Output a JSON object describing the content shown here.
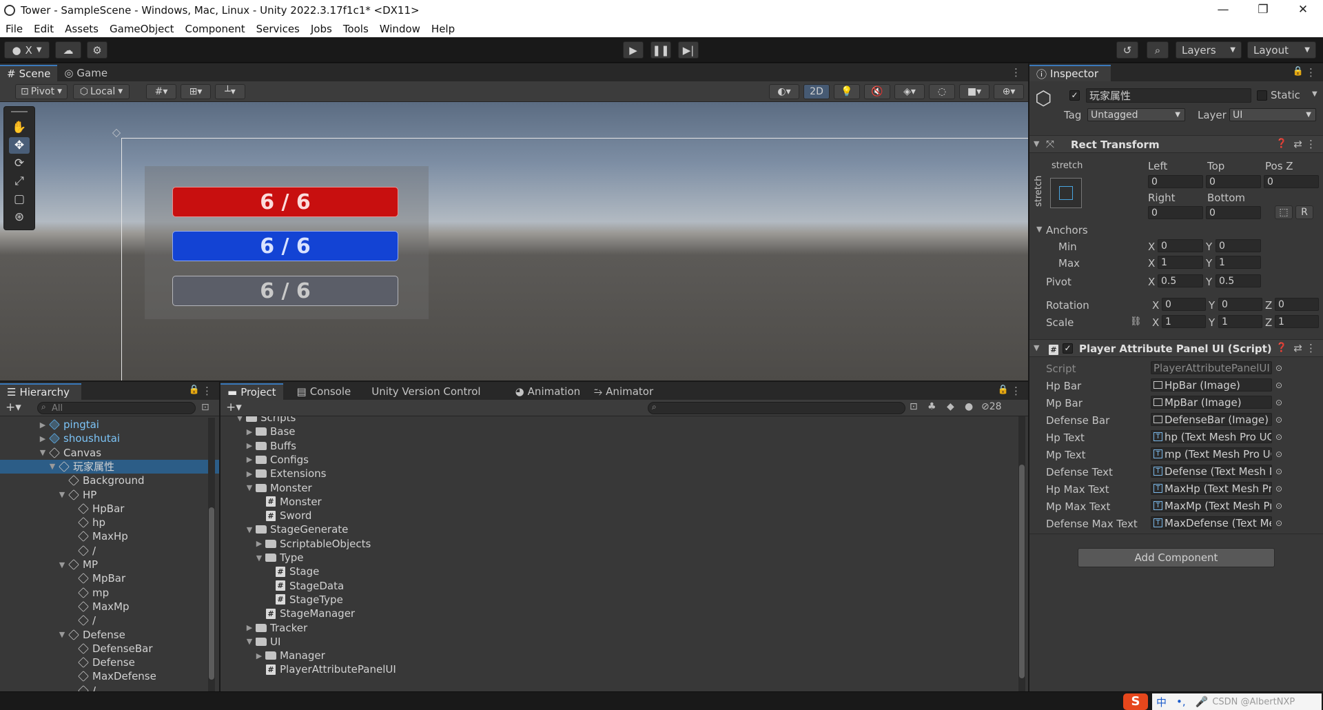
{
  "window": {
    "title": "Tower - SampleScene - Windows, Mac, Linux - Unity 2022.3.17f1c1* <DX11>"
  },
  "menu": [
    "File",
    "Edit",
    "Assets",
    "GameObject",
    "Component",
    "Services",
    "Jobs",
    "Tools",
    "Window",
    "Help"
  ],
  "toolbar": {
    "account_label": "X",
    "layers_label": "Layers",
    "layout_label": "Layout"
  },
  "scene": {
    "tabs": [
      "Scene",
      "Game"
    ],
    "pivot_label": "Pivot",
    "local_label": "Local",
    "mode_2d": "2D",
    "bars": [
      {
        "text": "6 / 6",
        "color": "#c80f0f"
      },
      {
        "text": "6 / 6",
        "color": "#1343d4"
      },
      {
        "text": "6 / 6",
        "color": "#5b5e68"
      }
    ]
  },
  "hierarchy": {
    "title": "Hierarchy",
    "search_placeholder": "All",
    "items": [
      {
        "label": "pingtai",
        "depth": 2,
        "arrow": "▶",
        "icon": "prefab"
      },
      {
        "label": "shoushutai",
        "depth": 2,
        "arrow": "▶",
        "icon": "prefab"
      },
      {
        "label": "Canvas",
        "depth": 2,
        "arrow": "▼",
        "icon": "cube"
      },
      {
        "label": "玩家属性",
        "depth": 3,
        "arrow": "▼",
        "icon": "cube",
        "selected": true
      },
      {
        "label": "Background",
        "depth": 4,
        "arrow": "",
        "icon": "cube"
      },
      {
        "label": "HP",
        "depth": 4,
        "arrow": "▼",
        "icon": "cube"
      },
      {
        "label": "HpBar",
        "depth": 5,
        "arrow": "",
        "icon": "cube"
      },
      {
        "label": "hp",
        "depth": 5,
        "arrow": "",
        "icon": "cube"
      },
      {
        "label": "MaxHp",
        "depth": 5,
        "arrow": "",
        "icon": "cube"
      },
      {
        "label": "/",
        "depth": 5,
        "arrow": "",
        "icon": "cube"
      },
      {
        "label": "MP",
        "depth": 4,
        "arrow": "▼",
        "icon": "cube"
      },
      {
        "label": "MpBar",
        "depth": 5,
        "arrow": "",
        "icon": "cube"
      },
      {
        "label": "mp",
        "depth": 5,
        "arrow": "",
        "icon": "cube"
      },
      {
        "label": "MaxMp",
        "depth": 5,
        "arrow": "",
        "icon": "cube"
      },
      {
        "label": "/",
        "depth": 5,
        "arrow": "",
        "icon": "cube"
      },
      {
        "label": "Defense",
        "depth": 4,
        "arrow": "▼",
        "icon": "cube"
      },
      {
        "label": "DefenseBar",
        "depth": 5,
        "arrow": "",
        "icon": "cube"
      },
      {
        "label": "Defense",
        "depth": 5,
        "arrow": "",
        "icon": "cube"
      },
      {
        "label": "MaxDefense",
        "depth": 5,
        "arrow": "",
        "icon": "cube"
      },
      {
        "label": "/",
        "depth": 5,
        "arrow": "",
        "icon": "cube"
      }
    ]
  },
  "project": {
    "tabs": [
      "Project",
      "Console",
      "Unity Version Control",
      "Animation",
      "Animator"
    ],
    "hidden_count": "28",
    "items": [
      {
        "label": "Scripts",
        "depth": 1,
        "arrow": "▼",
        "icon": "folder"
      },
      {
        "label": "Base",
        "depth": 2,
        "arrow": "▶",
        "icon": "folder"
      },
      {
        "label": "Buffs",
        "depth": 2,
        "arrow": "▶",
        "icon": "folder"
      },
      {
        "label": "Configs",
        "depth": 2,
        "arrow": "▶",
        "icon": "folder"
      },
      {
        "label": "Extensions",
        "depth": 2,
        "arrow": "▶",
        "icon": "folder"
      },
      {
        "label": "Monster",
        "depth": 2,
        "arrow": "▼",
        "icon": "folder"
      },
      {
        "label": "Monster",
        "depth": 3,
        "arrow": "",
        "icon": "script"
      },
      {
        "label": "Sword",
        "depth": 3,
        "arrow": "",
        "icon": "script"
      },
      {
        "label": "StageGenerate",
        "depth": 2,
        "arrow": "▼",
        "icon": "folder"
      },
      {
        "label": "ScriptableObjects",
        "depth": 3,
        "arrow": "▶",
        "icon": "folder"
      },
      {
        "label": "Type",
        "depth": 3,
        "arrow": "▼",
        "icon": "folder"
      },
      {
        "label": "Stage",
        "depth": 4,
        "arrow": "",
        "icon": "script"
      },
      {
        "label": "StageData",
        "depth": 4,
        "arrow": "",
        "icon": "script"
      },
      {
        "label": "StageType",
        "depth": 4,
        "arrow": "",
        "icon": "script"
      },
      {
        "label": "StageManager",
        "depth": 3,
        "arrow": "",
        "icon": "script"
      },
      {
        "label": "Tracker",
        "depth": 2,
        "arrow": "▶",
        "icon": "folder"
      },
      {
        "label": "UI",
        "depth": 2,
        "arrow": "▼",
        "icon": "folder"
      },
      {
        "label": "Manager",
        "depth": 3,
        "arrow": "▶",
        "icon": "folder"
      },
      {
        "label": "PlayerAttributePanelUI",
        "depth": 3,
        "arrow": "",
        "icon": "script"
      }
    ]
  },
  "inspector": {
    "title": "Inspector",
    "object_name": "玩家属性",
    "static_label": "Static",
    "tag_label": "Tag",
    "tag_value": "Untagged",
    "layer_label": "Layer",
    "layer_value": "UI",
    "rect": {
      "title": "Rect Transform",
      "stretch": "stretch",
      "left_label": "Left",
      "top_label": "Top",
      "posz_label": "Pos Z",
      "right_label": "Right",
      "bottom_label": "Bottom",
      "left": "0",
      "top": "0",
      "posz": "0",
      "right": "0",
      "bottom": "0",
      "r_btn": "R",
      "anchors_label": "Anchors",
      "min_label": "Min",
      "max_label": "Max",
      "pivot_label": "Pivot",
      "rotation_label": "Rotation",
      "scale_label": "Scale",
      "min_x": "0",
      "min_y": "0",
      "max_x": "1",
      "max_y": "1",
      "pivot_x": "0.5",
      "pivot_y": "0.5",
      "rot_x": "0",
      "rot_y": "0",
      "rot_z": "0",
      "scale_x": "1",
      "scale_y": "1",
      "scale_z": "1"
    },
    "script": {
      "title": "Player Attribute Panel UI (Script)",
      "fields": [
        {
          "label": "Script",
          "value": "PlayerAttributePanelUI",
          "kind": "script"
        },
        {
          "label": "Hp Bar",
          "value": "HpBar (Image)",
          "kind": "image"
        },
        {
          "label": "Mp Bar",
          "value": "MpBar (Image)",
          "kind": "image"
        },
        {
          "label": "Defense Bar",
          "value": "DefenseBar (Image)",
          "kind": "image"
        },
        {
          "label": "Hp Text",
          "value": "hp (Text Mesh Pro UGUI)",
          "kind": "text"
        },
        {
          "label": "Mp Text",
          "value": "mp (Text Mesh Pro UGUI)",
          "kind": "text"
        },
        {
          "label": "Defense Text",
          "value": "Defense (Text Mesh Pro UG",
          "kind": "text"
        },
        {
          "label": "Hp Max Text",
          "value": "MaxHp (Text Mesh Pro UGU",
          "kind": "text"
        },
        {
          "label": "Mp Max Text",
          "value": "MaxMp (Text Mesh Pro UGL",
          "kind": "text"
        },
        {
          "label": "Defense Max Text",
          "value": "MaxDefense (Text Mesh Prc",
          "kind": "text"
        }
      ]
    },
    "add_component": "Add Component"
  },
  "ime": {
    "lang": "中",
    "watermark": "CSDN @AlbertNXP"
  }
}
